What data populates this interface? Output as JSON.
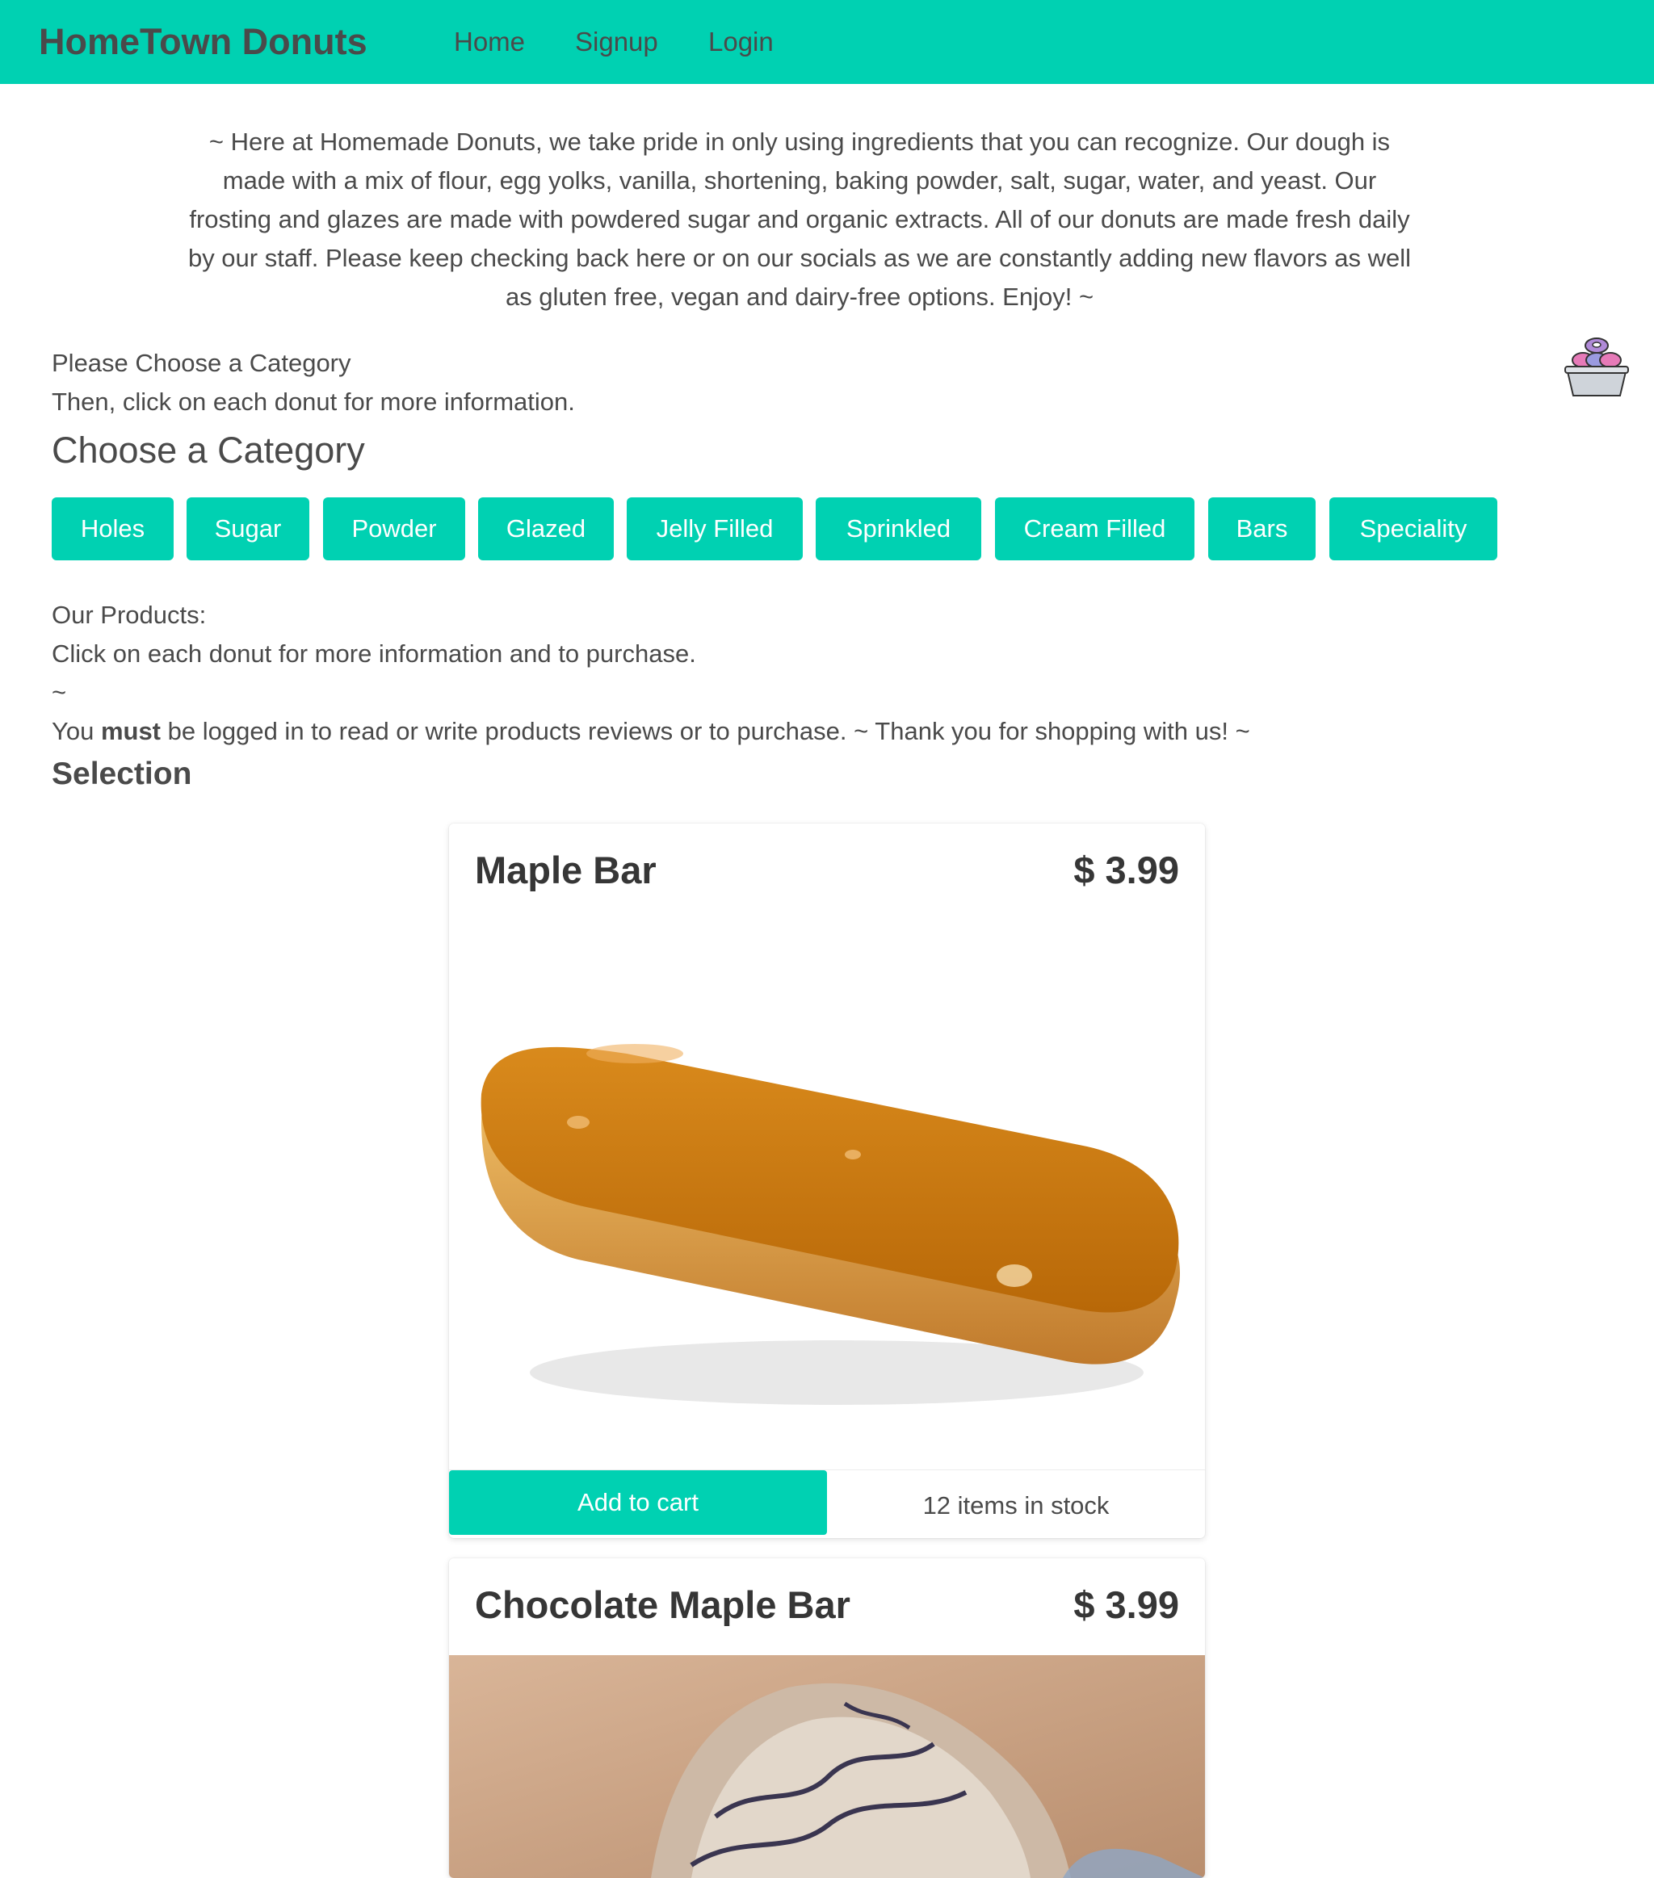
{
  "navbar": {
    "brand": "HomeTown Donuts",
    "items": [
      "Home",
      "Signup",
      "Login"
    ]
  },
  "intro": {
    "text": "~ Here at Homemade Donuts, we take pride in only using ingredients that you can recognize. Our dough is made with a mix of flour, egg yolks, vanilla, shortening, baking powder, salt, sugar, water, and yeast. Our frosting and glazes are made with powdered sugar and organic extracts. All of our donuts are made fresh daily by our staff. Please keep checking back here or on our socials as we are constantly adding new flavors as well as gluten free, vegan and dairy-free options. Enjoy! ~"
  },
  "category": {
    "prompt_line1": "Please Choose a Category",
    "prompt_line2": "Then, click on each donut for more information.",
    "title": "Choose a Category",
    "buttons": [
      "Holes",
      "Sugar",
      "Powder",
      "Glazed",
      "Jelly Filled",
      "Sprinkled",
      "Cream Filled",
      "Bars",
      "Speciality"
    ]
  },
  "products_info": {
    "line1": "Our Products:",
    "line2": "Click on each donut for more information and to purchase.",
    "line3": "~",
    "line4_prefix": "You ",
    "line4_bold": "must",
    "line4_suffix": " be logged in to read or write products reviews or to purchase. ~ Thank you for shopping with us! ~",
    "selection_title": "Selection"
  },
  "products": [
    {
      "name": "Maple Bar",
      "price": "$ 3.99",
      "add_to_cart": "Add to cart",
      "stock": "12 items in stock"
    },
    {
      "name": "Chocolate Maple Bar",
      "price": "$ 3.99"
    }
  ],
  "colors": {
    "accent": "#00d1b2",
    "text": "#4a4a4a",
    "heading": "#363636"
  },
  "icons": {
    "basket": "donut-basket-icon"
  }
}
